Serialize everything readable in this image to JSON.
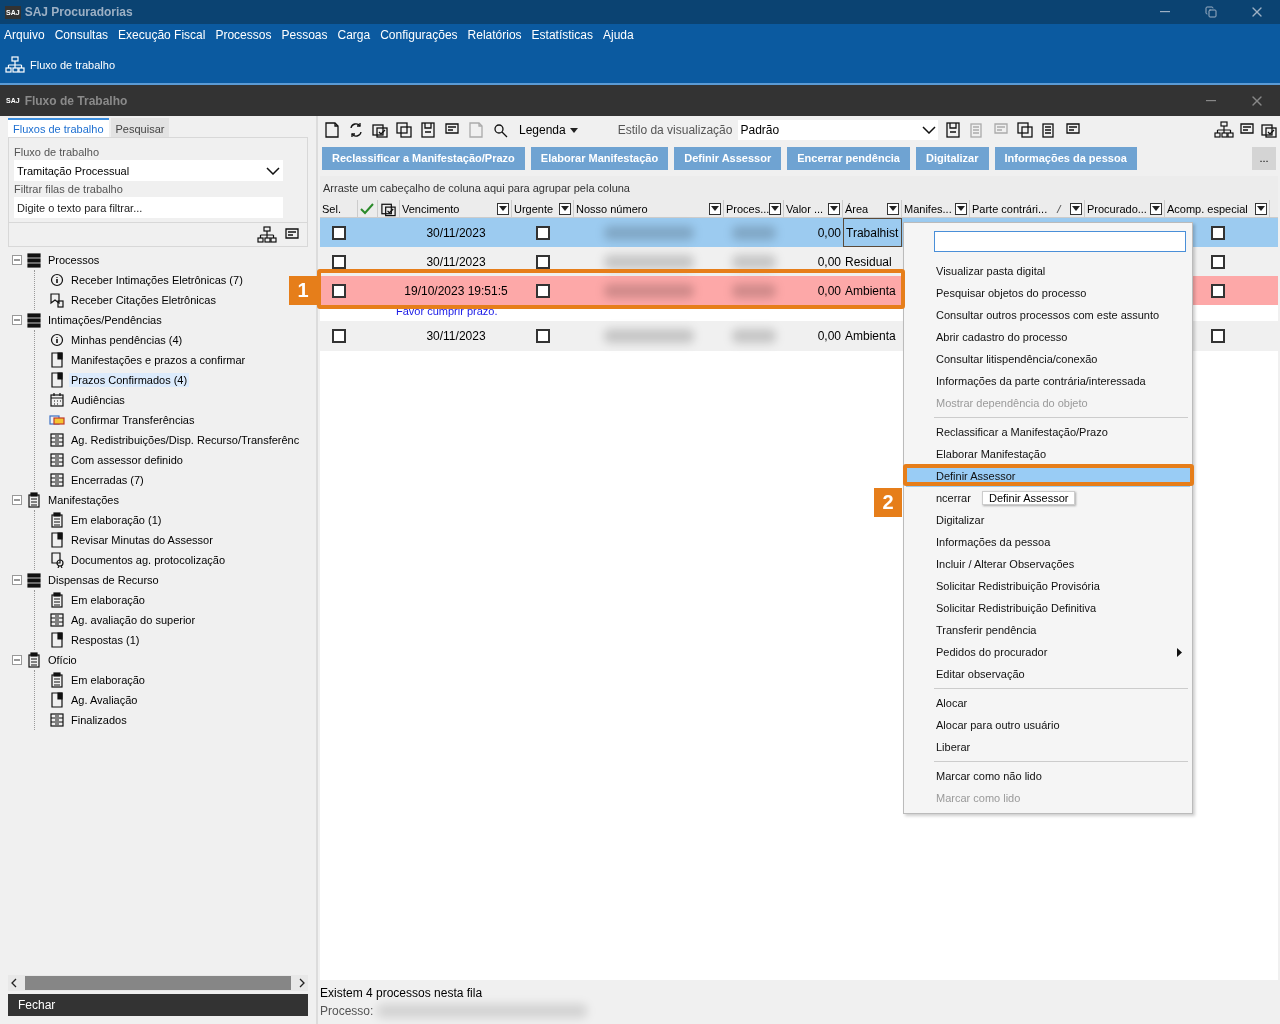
{
  "app_window": {
    "logo": "SAJ",
    "title": "SAJ Procuradorias"
  },
  "menu_bar": [
    "Arquivo",
    "Consultas",
    "Execução Fiscal",
    "Processos",
    "Pessoas",
    "Carga",
    "Configurações",
    "Relatórios",
    "Estatísticas",
    "Ajuda"
  ],
  "ribbon": {
    "label": "Fluxo de trabalho"
  },
  "child_window": {
    "logo": "SAJ",
    "title": "Fluxo de Trabalho"
  },
  "left_panel": {
    "tabs": [
      {
        "label": "Fluxos de trabalho",
        "selected": true
      },
      {
        "label": "Pesquisar",
        "selected": false
      }
    ],
    "workflow_label": "Fluxo de trabalho",
    "workflow_value": "Tramitação Processual",
    "filter_label": "Filtrar filas de trabalho",
    "filter_placeholder": "Digite o texto para filtrar...",
    "tree": [
      {
        "label": "Processos",
        "kind": "list",
        "selected": false,
        "expanded": true,
        "children": [
          {
            "label": "Receber Intimações Eletrônicas (7)",
            "kind": "info",
            "selected": false
          },
          {
            "label": "Receber Citações Eletrônicas",
            "kind": "citation",
            "selected": false
          }
        ]
      },
      {
        "label": "Intimações/Pendências",
        "kind": "list",
        "selected": false,
        "expanded": true,
        "children": [
          {
            "label": "Minhas pendências (4)",
            "kind": "info",
            "selected": false
          },
          {
            "label": "Manifestações e prazos a confirmar",
            "kind": "doc",
            "selected": false
          },
          {
            "label": "Prazos Confirmados (4)",
            "kind": "doc",
            "selected": true
          },
          {
            "label": "Audiências",
            "kind": "calendar",
            "selected": false
          },
          {
            "label": "Confirmar Transferências",
            "kind": "transfer",
            "selected": false
          },
          {
            "label": "Ag. Redistribuições/Disp. Recurso/Transferênc",
            "kind": "tray",
            "selected": false
          },
          {
            "label": "Com assessor definido",
            "kind": "tray",
            "selected": false
          },
          {
            "label": "Encerradas (7)",
            "kind": "tray",
            "selected": false
          }
        ]
      },
      {
        "label": "Manifestações",
        "kind": "clipboard",
        "selected": false,
        "expanded": true,
        "children": [
          {
            "label": "Em elaboração (1)",
            "kind": "clipboard",
            "selected": false
          },
          {
            "label": "Revisar Minutas do Assessor",
            "kind": "doc",
            "selected": false
          },
          {
            "label": "Documentos ag. protocolização",
            "kind": "certificate",
            "selected": false
          }
        ]
      },
      {
        "label": "Dispensas de Recurso",
        "kind": "list",
        "selected": false,
        "expanded": true,
        "children": [
          {
            "label": "Em elaboração",
            "kind": "clipboard",
            "selected": false
          },
          {
            "label": "Ag. avaliação do superior",
            "kind": "tray",
            "selected": false
          },
          {
            "label": "Respostas (1)",
            "kind": "doc",
            "selected": false
          }
        ]
      },
      {
        "label": "Ofício",
        "kind": "clipboard",
        "selected": false,
        "expanded": true,
        "children": [
          {
            "label": "Em elaboração",
            "kind": "clipboard",
            "selected": false
          },
          {
            "label": "Ag. Avaliação",
            "kind": "doc",
            "selected": false
          },
          {
            "label": "Finalizados",
            "kind": "tray",
            "selected": false
          }
        ]
      }
    ],
    "close_button": "Fechar"
  },
  "toolbar": {
    "legend": "Legenda",
    "style_label": "Estilo da visualização",
    "style_value": "Padrão"
  },
  "action_buttons": [
    "Reclassificar a Manifestação/Prazo",
    "Elaborar Manifestação",
    "Definir Assessor",
    "Encerrar pendência",
    "Digitalizar",
    "Informações da pessoa"
  ],
  "more_button": "...",
  "group_hint": "Arraste um cabeçalho de coluna aqui para agrupar pela coluna",
  "table": {
    "columns": [
      "Sel.",
      "Vencimento",
      "Urgente",
      "Nosso número",
      "Proces...",
      "Valor ...",
      "Área",
      "Manifes...",
      "Parte contrári...",
      "Procurado...",
      "Acomp. especial"
    ],
    "rows": [
      {
        "selected": true,
        "late": false,
        "checked": false,
        "due": "30/11/2023",
        "urgent": false,
        "value": "0,00",
        "area": "Trabalhist",
        "focused": true,
        "special": false
      },
      {
        "selected": false,
        "late": false,
        "checked": false,
        "due": "30/11/2023",
        "urgent": false,
        "value": "0,00",
        "area": "Residual",
        "focused": false,
        "special": false
      },
      {
        "selected": false,
        "late": true,
        "checked": false,
        "due": "19/10/2023 19:51:5",
        "urgent": false,
        "value": "0,00",
        "area": "Ambienta",
        "focused": false,
        "special": false,
        "note": "Favor cumprir prazo."
      },
      {
        "selected": false,
        "late": false,
        "checked": false,
        "due": "30/11/2023",
        "urgent": false,
        "value": "0,00",
        "area": "Ambienta",
        "focused": false,
        "special": false
      }
    ]
  },
  "status_bar": {
    "count": "Existem 4 processos nesta fila",
    "process_label": "Processo:"
  },
  "context_menu": {
    "items": [
      {
        "kind": "search"
      },
      {
        "kind": "item",
        "label": "Visualizar pasta digital",
        "disabled": false,
        "selected": false
      },
      {
        "kind": "item",
        "label": "Pesquisar objetos do processo",
        "disabled": false,
        "selected": false
      },
      {
        "kind": "item",
        "label": "Consultar outros processos com este assunto",
        "disabled": false,
        "selected": false
      },
      {
        "kind": "item",
        "label": "Abrir cadastro do processo",
        "disabled": false,
        "selected": false
      },
      {
        "kind": "item",
        "label": "Consultar litispendência/conexão",
        "disabled": false,
        "selected": false
      },
      {
        "kind": "item",
        "label": "Informações da parte contrária/interessada",
        "disabled": false,
        "selected": false
      },
      {
        "kind": "item",
        "label": "Mostrar dependência do objeto",
        "disabled": true,
        "selected": false
      },
      {
        "kind": "separator"
      },
      {
        "kind": "item",
        "label": "Reclassificar a Manifestação/Prazo",
        "disabled": false,
        "selected": false
      },
      {
        "kind": "item",
        "label": "Elaborar Manifestação",
        "disabled": false,
        "selected": false
      },
      {
        "kind": "item",
        "label": "Definir Assessor",
        "disabled": false,
        "selected": true,
        "tooltip": "Definir Assessor"
      },
      {
        "kind": "item",
        "label": "ncerrar",
        "disabled": false,
        "selected": false
      },
      {
        "kind": "item",
        "label": "Digitalizar",
        "disabled": false,
        "selected": false
      },
      {
        "kind": "item",
        "label": "Informações da pessoa",
        "disabled": false,
        "selected": false
      },
      {
        "kind": "item",
        "label": "Incluir / Alterar Observações",
        "disabled": false,
        "selected": false
      },
      {
        "kind": "item",
        "label": "Solicitar Redistribuição Provisória",
        "disabled": false,
        "selected": false
      },
      {
        "kind": "item",
        "label": "Solicitar Redistribuição Definitiva",
        "disabled": false,
        "selected": false
      },
      {
        "kind": "item",
        "label": "Transferir pendência",
        "disabled": false,
        "selected": false
      },
      {
        "kind": "item",
        "label": "Pedidos do procurador",
        "disabled": false,
        "selected": false,
        "submenu": true
      },
      {
        "kind": "item",
        "label": "Editar observação",
        "disabled": false,
        "selected": false
      },
      {
        "kind": "separator"
      },
      {
        "kind": "item",
        "label": "Alocar",
        "disabled": false,
        "selected": false
      },
      {
        "kind": "item",
        "label": "Alocar para outro usuário",
        "disabled": false,
        "selected": false
      },
      {
        "kind": "item",
        "label": "Liberar",
        "disabled": false,
        "selected": false
      },
      {
        "kind": "separator"
      },
      {
        "kind": "item",
        "label": "Marcar como não lido",
        "disabled": false,
        "selected": false
      },
      {
        "kind": "item",
        "label": "Marcar como lido",
        "disabled": true,
        "selected": false
      }
    ]
  },
  "callouts": [
    {
      "label": "1"
    },
    {
      "label": "2"
    }
  ]
}
